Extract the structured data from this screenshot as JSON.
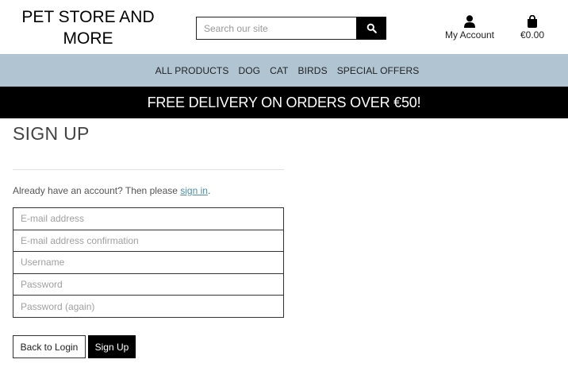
{
  "header": {
    "brand": "PET STORE AND MORE",
    "search": {
      "placeholder": "Search our site"
    },
    "account_label": "My Account",
    "cart_total": "€0.00"
  },
  "nav": {
    "items": [
      {
        "label": "ALL PRODUCTS"
      },
      {
        "label": "DOG"
      },
      {
        "label": "CAT"
      },
      {
        "label": "BIRDS"
      },
      {
        "label": "SPECIAL OFFERS"
      }
    ]
  },
  "banner": {
    "text": "FREE DELIVERY ON ORDERS OVER €50!"
  },
  "signup": {
    "title": "SIGN UP",
    "already_text": "Already have an account? Then please ",
    "signin_link": "sign in",
    "already_suffix": ".",
    "fields": {
      "email": {
        "placeholder": "E-mail address"
      },
      "email_confirm": {
        "placeholder": "E-mail address confirmation"
      },
      "username": {
        "placeholder": "Username"
      },
      "password": {
        "placeholder": "Password"
      },
      "password_again": {
        "placeholder": "Password (again)"
      }
    },
    "back_button": "Back to Login",
    "submit_button": "Sign Up"
  },
  "icons": {
    "search": "search-icon",
    "account": "user-icon",
    "cart": "shopping-bag-icon"
  }
}
